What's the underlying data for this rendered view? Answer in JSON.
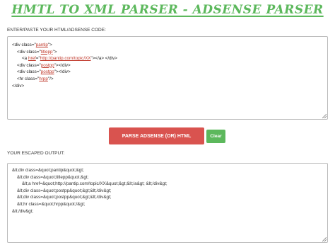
{
  "page": {
    "title": "HMTL TO XML PARSER - ADSENSE PARSER"
  },
  "input": {
    "label": "ENTER/PASTE YOUR HTML/ADSENSE CODE:",
    "lines": [
      {
        "indent": "",
        "parts": [
          {
            "t": "<div class=\"",
            "c": "tag"
          },
          {
            "t": "pantip",
            "c": "val"
          },
          {
            "t": "\">",
            "c": "tag"
          }
        ]
      },
      {
        "indent": "    ",
        "parts": [
          {
            "t": "<div class=\"",
            "c": "tag"
          },
          {
            "t": "titlepp",
            "c": "val"
          },
          {
            "t": "\">",
            "c": "tag"
          }
        ]
      },
      {
        "indent": "        ",
        "parts": [
          {
            "t": "<a ",
            "c": "tag"
          },
          {
            "t": "href",
            "c": "val"
          },
          {
            "t": "=\"",
            "c": "tag"
          },
          {
            "t": "http://pantip.com/topic/XX",
            "c": "val"
          },
          {
            "t": "\"></a> </div>",
            "c": "tag"
          }
        ]
      },
      {
        "indent": "    ",
        "parts": [
          {
            "t": "<div class=\"",
            "c": "tag"
          },
          {
            "t": "postpp",
            "c": "val"
          },
          {
            "t": "\"></div>",
            "c": "tag"
          }
        ]
      },
      {
        "indent": "    ",
        "parts": [
          {
            "t": "<div class=\"",
            "c": "tag"
          },
          {
            "t": "postpp",
            "c": "val"
          },
          {
            "t": "\"></div>",
            "c": "tag"
          }
        ]
      },
      {
        "indent": "    ",
        "parts": [
          {
            "t": "<hr class=\"",
            "c": "tag"
          },
          {
            "t": "hrpp",
            "c": "val"
          },
          {
            "t": "\"/>",
            "c": "tag"
          }
        ]
      },
      {
        "indent": "",
        "parts": [
          {
            "t": "</div>",
            "c": "tag"
          }
        ]
      }
    ]
  },
  "buttons": {
    "parse_label": "PARSE ADSENSE (OR) HTML",
    "clear_label": "Clear"
  },
  "output": {
    "label": "YOUR ESCAPED OUTPUT:",
    "lines": [
      "&lt;div class=&quot;pantip&quot;&gt;",
      "    &lt;div class=&quot;titlepp&quot;&gt;",
      "        &lt;a href=&quot;http://pantip.com/topic/XX&quot;&gt;&lt;/a&gt; &lt;/div&gt;",
      "    &lt;div class=&quot;postpp&quot;&gt;&lt;/div&gt;",
      "    &lt;div class=&quot;postpp&quot;&gt;&lt;/div&gt;",
      "    &lt;hr class=&quot;hrpp&quot;/&gt;",
      "&lt;/div&gt;"
    ]
  }
}
